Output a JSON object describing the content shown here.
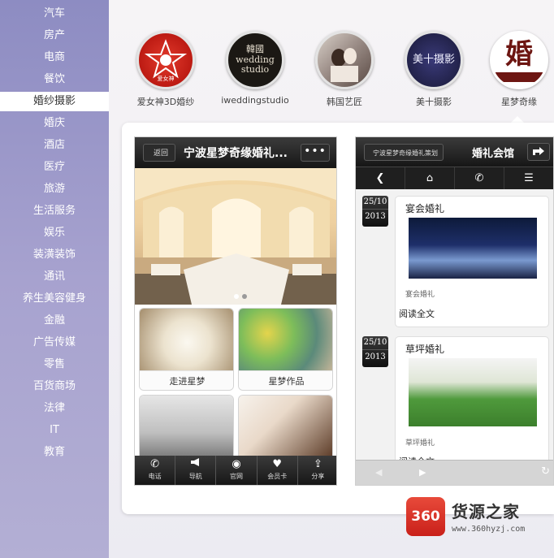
{
  "sidebar": {
    "items": [
      {
        "label": "汽车"
      },
      {
        "label": "房产"
      },
      {
        "label": "电商"
      },
      {
        "label": "餐饮"
      },
      {
        "label": "婚纱摄影",
        "active": true
      },
      {
        "label": "婚庆"
      },
      {
        "label": "酒店"
      },
      {
        "label": "医疗"
      },
      {
        "label": "旅游"
      },
      {
        "label": "生活服务"
      },
      {
        "label": "娱乐"
      },
      {
        "label": "装潢装饰"
      },
      {
        "label": "通讯"
      },
      {
        "label": "养生美容健身"
      },
      {
        "label": "金融"
      },
      {
        "label": "广告传媒"
      },
      {
        "label": "零售"
      },
      {
        "label": "百货商场"
      },
      {
        "label": "法律"
      },
      {
        "label": "IT"
      },
      {
        "label": "教育"
      }
    ]
  },
  "brands": [
    {
      "caption": "爱女神3D婚纱",
      "logo_text": "爱女神",
      "color": "#c8221d",
      "active": false
    },
    {
      "caption": "iweddingstudio",
      "logo_text": "韓國 wedding studio",
      "color": "#1e1a17",
      "active": false
    },
    {
      "caption": "韩国艺匠",
      "logo_text": "",
      "color": "#8b7e7c",
      "active": false
    },
    {
      "caption": "美十摄影",
      "logo_text": "美十摄影",
      "color": "#2a2a5a",
      "active": false
    },
    {
      "caption": "星梦奇缘",
      "logo_text": "婚",
      "color": "#6d1612",
      "active": true
    }
  ],
  "phone1": {
    "back_label": "返回",
    "title": "宁波星梦奇缘婚礼...",
    "more_label": "•••",
    "tiles": [
      {
        "label": "走进星梦"
      },
      {
        "label": "星梦作品"
      },
      {
        "label": ""
      },
      {
        "label": ""
      }
    ],
    "bottom_bar": [
      {
        "label": "电话",
        "icon": "phone-icon",
        "glyph": "✆"
      },
      {
        "label": "导航",
        "icon": "megaphone-icon",
        "glyph": "📢"
      },
      {
        "label": "官网",
        "icon": "globe-icon",
        "glyph": "◉"
      },
      {
        "label": "会员卡",
        "icon": "heart-icon",
        "glyph": "♥"
      },
      {
        "label": "分享",
        "icon": "share-icon",
        "glyph": "⇪"
      }
    ]
  },
  "phone2": {
    "back_label": "宁波星梦奇缘婚礼策划",
    "title": "婚礼会馆",
    "nav": [
      {
        "icon": "back-circle-icon",
        "glyph": "❮"
      },
      {
        "icon": "home-icon",
        "glyph": "⌂"
      },
      {
        "icon": "phone-icon",
        "glyph": "✆"
      },
      {
        "icon": "list-icon",
        "glyph": "☰"
      }
    ],
    "posts": [
      {
        "day": "25/10",
        "year": "2013",
        "title": "宴会婚礼",
        "category": "宴会婚礼",
        "more": "阅读全文"
      },
      {
        "day": "25/10",
        "year": "2013",
        "title": "草坪婚礼",
        "category": "草坪婚礼",
        "more": "阅读全文"
      }
    ],
    "pager": {
      "prev": "◀",
      "next": "▶",
      "refresh": "↻"
    }
  },
  "watermark": {
    "badge": "360",
    "name": "货源之家",
    "url": "www.360hyzj.com"
  }
}
